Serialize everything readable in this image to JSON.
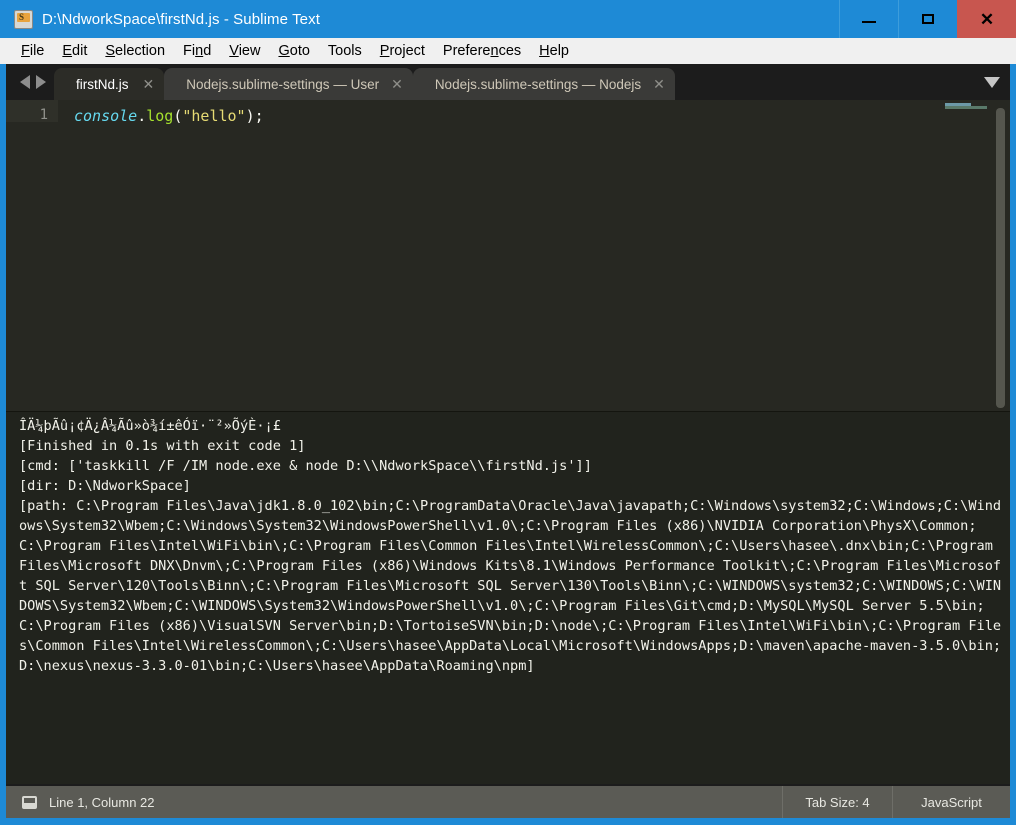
{
  "window": {
    "title": "D:\\NdworkSpace\\firstNd.js - Sublime Text",
    "app_icon": "sublime-text-icon",
    "controls": {
      "minimize": "minimize-icon",
      "maximize": "maximize-icon",
      "close": "✕"
    },
    "accent_color": "#1e8ad6",
    "close_color": "#c8564f"
  },
  "menu": {
    "items": [
      {
        "label": "File",
        "mnemonic": "F"
      },
      {
        "label": "Edit",
        "mnemonic": "E"
      },
      {
        "label": "Selection",
        "mnemonic": "S"
      },
      {
        "label": "Find",
        "mnemonic": "n"
      },
      {
        "label": "View",
        "mnemonic": "V"
      },
      {
        "label": "Goto",
        "mnemonic": "G"
      },
      {
        "label": "Tools",
        "mnemonic": "T"
      },
      {
        "label": "Project",
        "mnemonic": "P"
      },
      {
        "label": "Preferences",
        "mnemonic": "n"
      },
      {
        "label": "Help",
        "mnemonic": "H"
      }
    ]
  },
  "tabs": {
    "prev_label": "◀",
    "next_label": "▶",
    "items": [
      {
        "label": "firstNd.js",
        "active": true,
        "close": "✕"
      },
      {
        "label": "Nodejs.sublime-settings — User",
        "active": false,
        "close": "✕"
      },
      {
        "label": "Nodejs.sublime-settings — Nodejs",
        "active": false,
        "close": "✕"
      }
    ],
    "overflow_menu": "chevron-down-icon"
  },
  "editor": {
    "line_numbers": [
      "1"
    ],
    "code_tokens": [
      {
        "text": "console",
        "type": "object"
      },
      {
        "text": ".",
        "type": "punctuation"
      },
      {
        "text": "log",
        "type": "function"
      },
      {
        "text": "(",
        "type": "paren"
      },
      {
        "text": "\"hello\"",
        "type": "string"
      },
      {
        "text": ")",
        "type": "paren"
      },
      {
        "text": ";",
        "type": "punctuation"
      }
    ],
    "code_plain": "console.log(\"hello\");",
    "background": "#272822"
  },
  "console": {
    "lines": [
      "ÎÄ¼þÃû¡¢Ä¿Â¼Ãû»ò¾í±êÓï·¨²»ÕýÈ·¡£",
      "[Finished in 0.1s with exit code 1]",
      "[cmd: ['taskkill /F /IM node.exe & node D:\\\\NdworkSpace\\\\firstNd.js']]",
      "[dir: D:\\NdworkSpace]",
      "[path: C:\\Program Files\\Java\\jdk1.8.0_102\\bin;C:\\ProgramData\\Oracle\\Java\\javapath;C:\\Windows\\system32;C:\\Windows;C:\\Windows\\System32\\Wbem;C:\\Windows\\System32\\WindowsPowerShell\\v1.0\\;C:\\Program Files (x86)\\NVIDIA Corporation\\PhysX\\Common;C:\\Program Files\\Intel\\WiFi\\bin\\;C:\\Program Files\\Common Files\\Intel\\WirelessCommon\\;C:\\Users\\hasee\\.dnx\\bin;C:\\Program Files\\Microsoft DNX\\Dnvm\\;C:\\Program Files (x86)\\Windows Kits\\8.1\\Windows Performance Toolkit\\;C:\\Program Files\\Microsoft SQL Server\\120\\Tools\\Binn\\;C:\\Program Files\\Microsoft SQL Server\\130\\Tools\\Binn\\;C:\\WINDOWS\\system32;C:\\WINDOWS;C:\\WINDOWS\\System32\\Wbem;C:\\WINDOWS\\System32\\WindowsPowerShell\\v1.0\\;C:\\Program Files\\Git\\cmd;D:\\MySQL\\MySQL Server 5.5\\bin;C:\\Program Files (x86)\\VisualSVN Server\\bin;D:\\TortoiseSVN\\bin;D:\\node\\;C:\\Program Files\\Intel\\WiFi\\bin\\;C:\\Program Files\\Common Files\\Intel\\WirelessCommon\\;C:\\Users\\hasee\\AppData\\Local\\Microsoft\\WindowsApps;D:\\maven\\apache-maven-3.5.0\\bin;D:\\nexus\\nexus-3.3.0-01\\bin;C:\\Users\\hasee\\AppData\\Roaming\\npm]"
    ]
  },
  "status_bar": {
    "panel_toggle": "panel-toggle-icon",
    "cursor_position": "Line 1, Column 22",
    "tab_size": "Tab Size: 4",
    "syntax": "JavaScript"
  }
}
